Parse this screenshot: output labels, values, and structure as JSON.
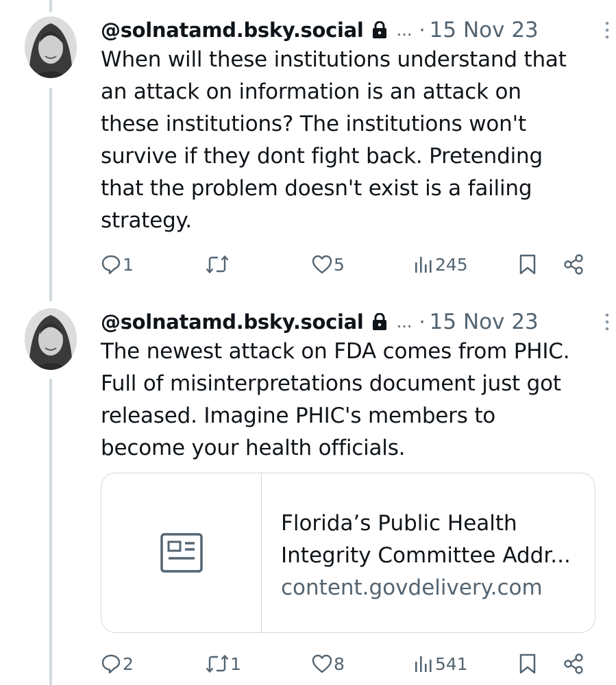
{
  "tweets": [
    {
      "handle": "@solnatamd.bsky.social",
      "ellipsis": "...",
      "separator": "·",
      "date": "15 Nov 23",
      "text": "When will these institutions understand that\nan attack on information is an attack on\nthese institutions? The institutions won't\nsurvive if they dont fight back. Pretending\nthat the problem doesn't exist is a failing\nstrategy.",
      "actions": {
        "replies": "1",
        "reposts": "",
        "likes": "5",
        "views": "245"
      }
    },
    {
      "handle": "@solnatamd.bsky.social",
      "ellipsis": "...",
      "separator": "·",
      "date": "15 Nov 23",
      "text": "The newest attack on FDA comes from PHIC.\nFull of misinterpretations document just got\nreleased. Imagine PHIC's members to\nbecome your health officials.",
      "card": {
        "title": "Florida’s Public Health\nIntegrity Committee Addr...",
        "domain": "content.govdelivery.com"
      },
      "actions": {
        "replies": "2",
        "reposts": "1",
        "likes": "8",
        "views": "541"
      }
    }
  ],
  "icons": {
    "lock": "lock-icon",
    "more": "more-options-icon",
    "reply": "reply-icon",
    "repost": "repost-icon",
    "like": "heart-icon",
    "views": "views-icon",
    "bookmark": "bookmark-icon",
    "share": "share-icon",
    "article": "article-icon"
  },
  "colors": {
    "text": "#0f1419",
    "muted": "#536471",
    "border": "#cfd9de"
  }
}
